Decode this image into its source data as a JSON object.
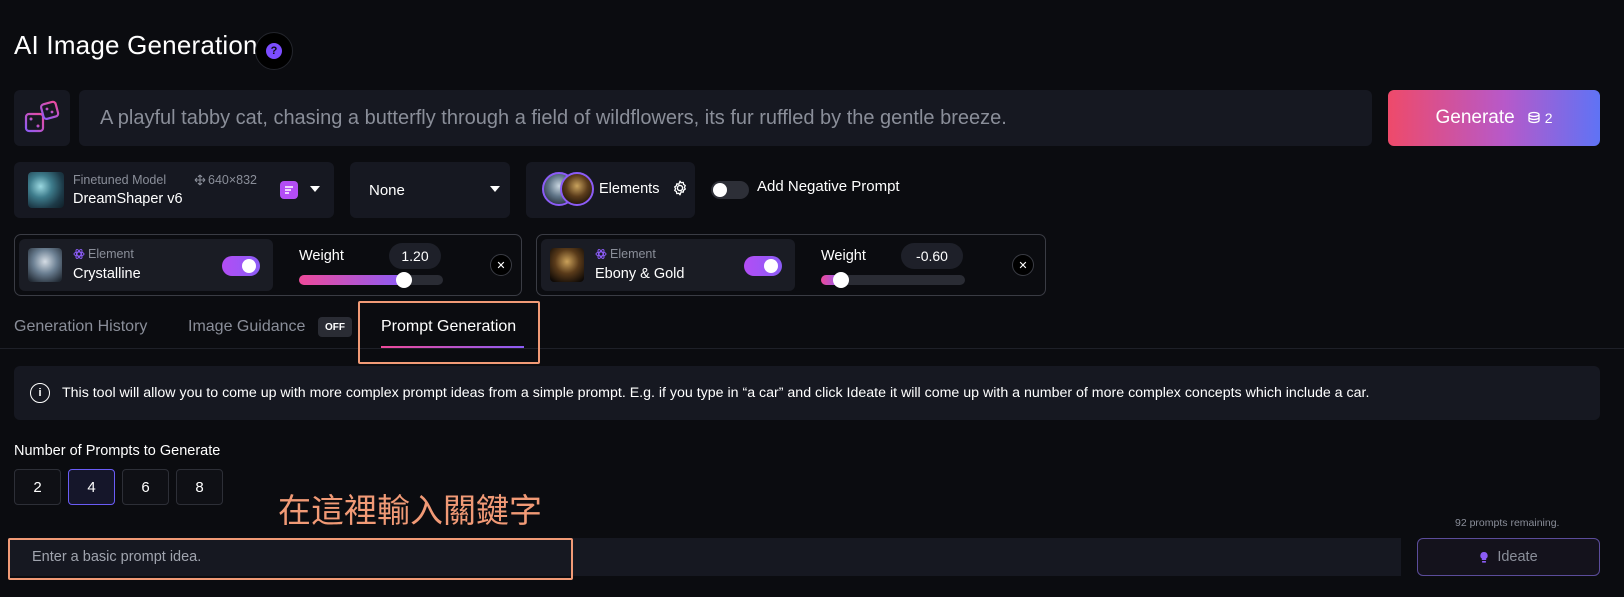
{
  "header": {
    "title": "AI Image Generation",
    "help_glyph": "?"
  },
  "prompt": {
    "text": "A playful tabby cat, chasing a butterfly through a field of wildflowers, its fur ruffled by the gentle breeze."
  },
  "generate": {
    "label": "Generate",
    "cost": "2"
  },
  "model": {
    "subtitle": "Finetuned Model",
    "dimensions": "640×832",
    "name": "DreamShaper v6"
  },
  "style": {
    "selected": "None"
  },
  "elements_button": {
    "label": "Elements"
  },
  "negative_prompt": {
    "label": "Add Negative Prompt",
    "enabled": false
  },
  "elements": [
    {
      "tag": "Element",
      "name": "Crystalline",
      "enabled": true,
      "weight_label": "Weight",
      "weight": "1.20",
      "weight_fraction": 0.7
    },
    {
      "tag": "Element",
      "name": "Ebony & Gold",
      "enabled": true,
      "weight_label": "Weight",
      "weight": "-0.60",
      "weight_fraction": 0.13
    }
  ],
  "tabs": {
    "history": "Generation History",
    "guidance": "Image Guidance",
    "guidance_badge": "OFF",
    "prompt_gen": "Prompt Generation"
  },
  "info": {
    "text": "This tool will allow you to come up with more complex prompt ideas from a simple prompt. E.g. if you type in “a car” and click Ideate it will come up with a number of more complex concepts which include a car."
  },
  "num_prompts": {
    "label": "Number of Prompts to Generate",
    "options": [
      "2",
      "4",
      "6",
      "8"
    ],
    "selected": "4"
  },
  "annotation": "在這裡輸入關鍵字",
  "remaining": "92 prompts remaining.",
  "idea_input": {
    "placeholder": "Enter a basic prompt idea."
  },
  "ideate": {
    "label": "Ideate"
  },
  "colors": {
    "accent_purple": "#8b5cf6",
    "accent_pink": "#ee4a9a",
    "annotation_orange": "#f19a76"
  }
}
